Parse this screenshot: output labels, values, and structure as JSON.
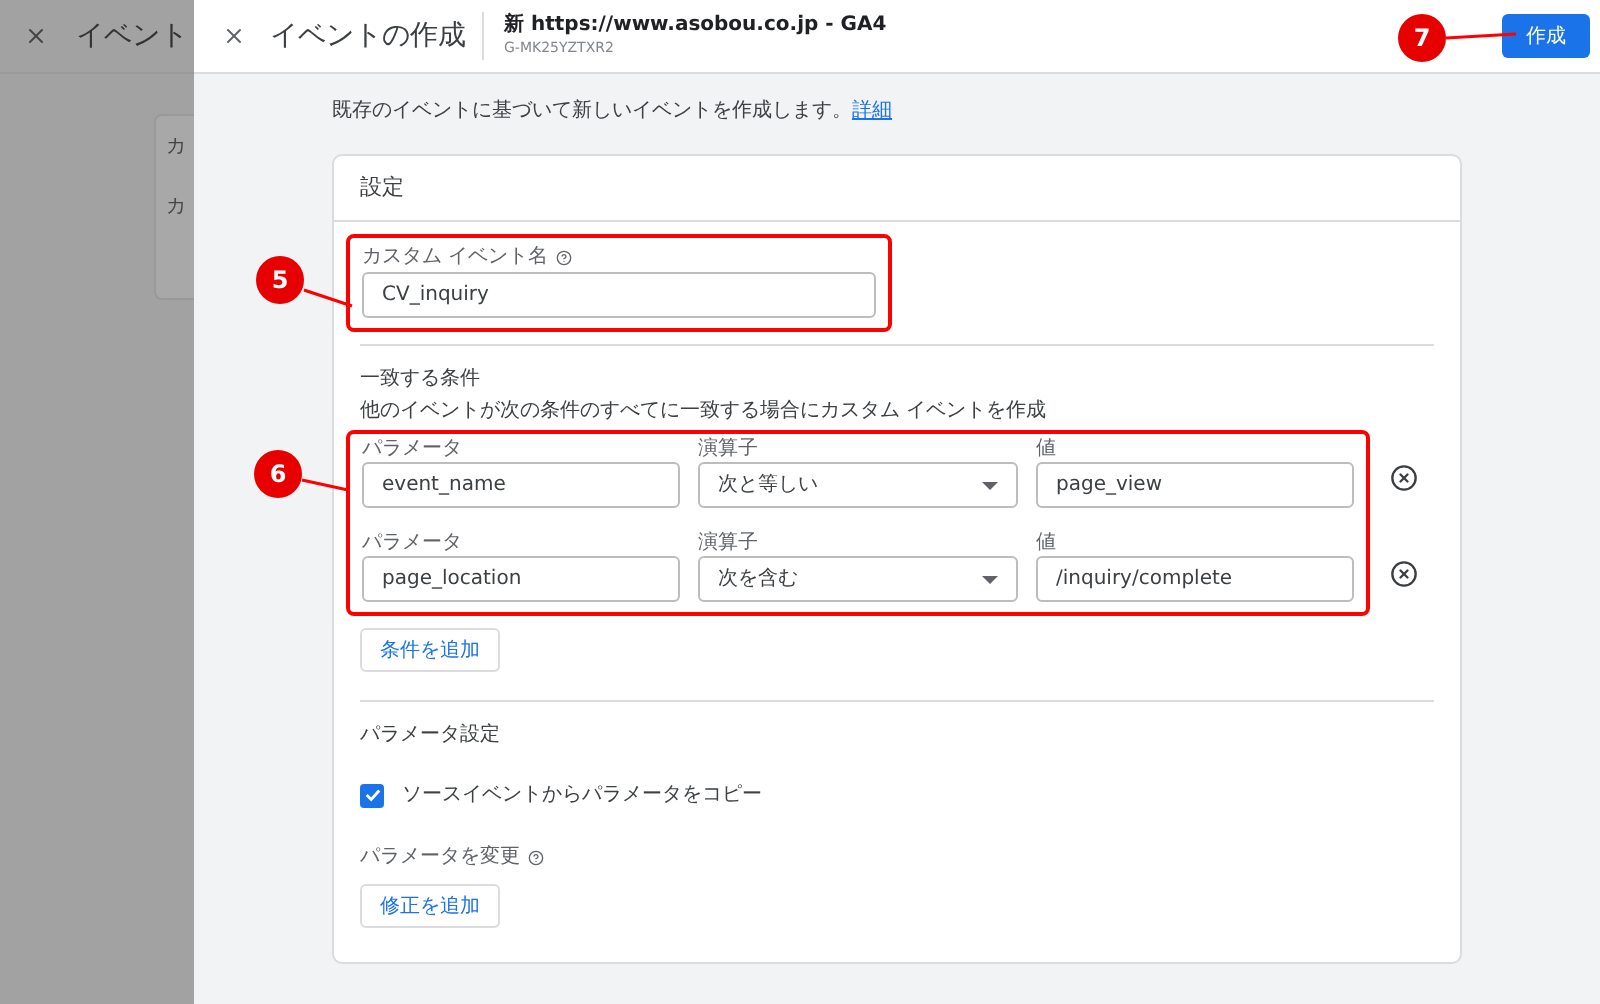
{
  "background": {
    "title": "イベント",
    "card_lines": [
      "カ",
      "カ"
    ]
  },
  "header": {
    "title": "イベントの作成",
    "property": "新 https://www.asobou.co.jp - GA4",
    "property_id": "G-MK25YZTXR2",
    "create_button": "作成"
  },
  "intro": {
    "text": "既存のイベントに基づいて新しいイベントを作成します。",
    "link": "詳細"
  },
  "settings": {
    "title": "設定",
    "event_name": {
      "label": "カスタム イベント名",
      "value": "CV_inquiry"
    }
  },
  "conditions": {
    "title": "一致する条件",
    "description": "他のイベントが次の条件のすべてに一致する場合にカスタム イベントを作成",
    "rows": [
      {
        "parameter_label": "パラメータ",
        "parameter": "event_name",
        "operator_label": "演算子",
        "operator": "次と等しい",
        "value_label": "値",
        "value": "page_view"
      },
      {
        "parameter_label": "パラメータ",
        "parameter": "page_location",
        "operator_label": "演算子",
        "operator": "次を含む",
        "value_label": "値",
        "value": "/inquiry/complete"
      }
    ],
    "add_button": "条件を追加"
  },
  "parameters": {
    "title": "パラメータ設定",
    "copy": {
      "label": "ソースイベントからパラメータをコピー",
      "checked": true
    },
    "modify_label": "パラメータを変更",
    "add_button": "修正を追加"
  },
  "annotations": [
    {
      "number": "5"
    },
    {
      "number": "6"
    },
    {
      "number": "7"
    }
  ]
}
